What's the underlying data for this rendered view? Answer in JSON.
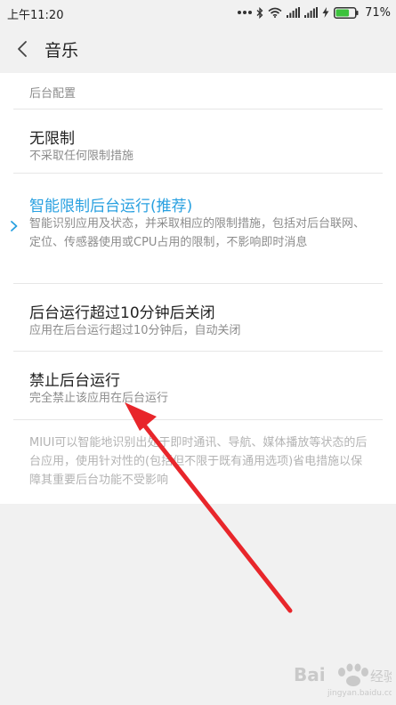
{
  "status_bar": {
    "time": "上午11:20",
    "battery_percent": "71%",
    "icons": [
      "more-dots-icon",
      "bluetooth-icon",
      "wifi-icon",
      "signal-icon",
      "signal-icon",
      "charging-icon",
      "battery-icon"
    ],
    "battery_level": 0.71,
    "battery_color": "#3cc23c"
  },
  "header": {
    "back_icon": "chevron-left-icon",
    "title": "音乐"
  },
  "section": {
    "label": "后台配置"
  },
  "options": [
    {
      "title": "无限制",
      "description": "不采取任何限制措施",
      "selected": false
    },
    {
      "title": "智能限制后台运行(推荐)",
      "description": "智能识别应用及状态，并采取相应的限制措施，包括对后台联网、定位、传感器使用或CPU占用的限制，不影响即时消息",
      "selected": true
    },
    {
      "title": "后台运行超过10分钟后关闭",
      "description": "应用在后台运行超过10分钟后，自动关闭",
      "selected": false
    },
    {
      "title": "禁止后台运行",
      "description": "完全禁止该应用在后台运行",
      "selected": false
    }
  ],
  "footer_note": "MIUI可以智能地识别出处于即时通讯、导航、媒体播放等状态的后台应用，使用针对性的(包括但不限于既有通用选项)省电措施以保障其重要后台功能不受影响",
  "colors": {
    "accent": "#28a0e0",
    "annotation_arrow": "#e8262b",
    "background": "#f1f1f1"
  },
  "watermark_text": "Bai经验"
}
